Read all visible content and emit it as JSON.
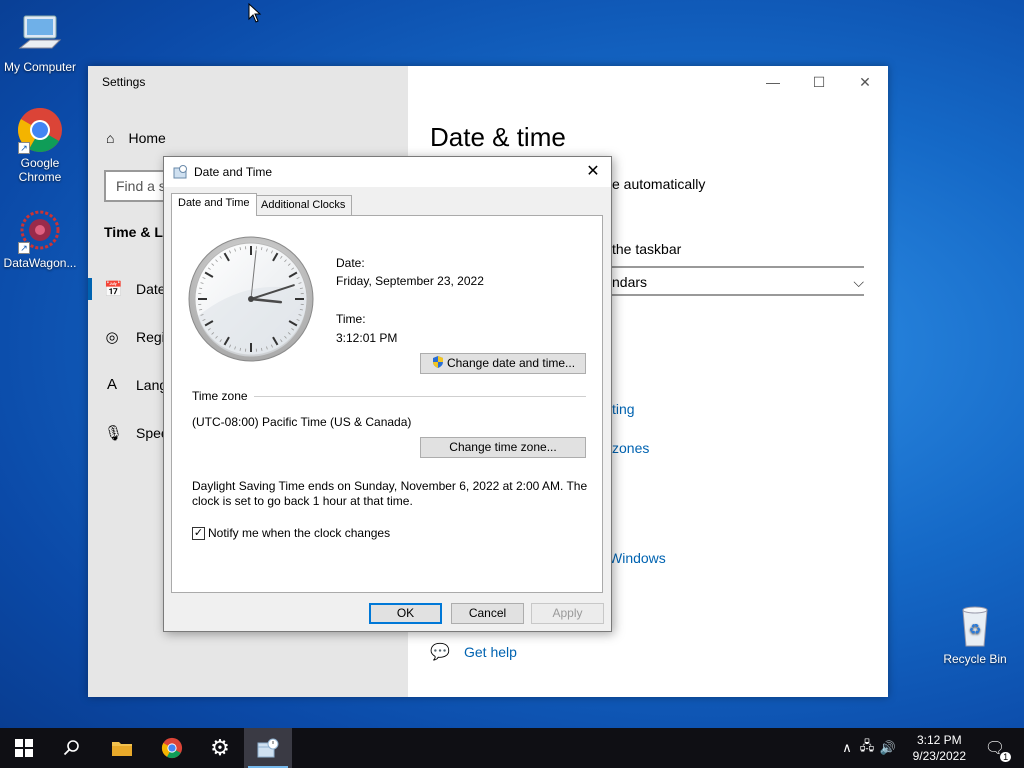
{
  "desktop": {
    "icons": [
      {
        "label": "My Computer"
      },
      {
        "label": "Google Chrome"
      },
      {
        "label": "DataWagon..."
      },
      {
        "label": "Recycle Bin"
      }
    ]
  },
  "settings": {
    "title": "Settings",
    "home": "Home",
    "search_placeholder": "Find a s",
    "section": "Time & La",
    "nav": [
      "Date",
      "Regi",
      "Lang",
      "Spee"
    ],
    "heading": "Date & time",
    "right": {
      "auto": "e automatically",
      "taskbar": "the taskbar",
      "calendars": "ndars",
      "link1": "ting",
      "link2": "zones",
      "link3": "Windows",
      "help": "Get help"
    }
  },
  "dialog": {
    "title": "Date and Time",
    "tabs": [
      "Date and Time",
      "Additional Clocks"
    ],
    "date_label": "Date:",
    "date_value": "Friday, September 23, 2022",
    "time_label": "Time:",
    "time_value": "3:12:01 PM",
    "change_datetime": "Change date and time...",
    "timezone_label": "Time zone",
    "timezone_value": "(UTC-08:00) Pacific Time (US & Canada)",
    "change_timezone": "Change time zone...",
    "dst_line1": "Daylight Saving Time ends on Sunday, November 6, 2022 at 2:00 AM. The",
    "dst_line2": "clock is set to go back 1 hour at that time.",
    "notify_label": "Notify me when the clock changes",
    "notify_checked": true,
    "ok": "OK",
    "cancel": "Cancel",
    "apply": "Apply"
  },
  "clock_face": {
    "hour": 3,
    "minute": 12,
    "second": 1
  },
  "taskbar": {
    "time": "3:12 PM",
    "date": "9/23/2022",
    "notifications": "1"
  },
  "colors": {
    "accent": "#0063b1",
    "taskbar": "#0f0f14"
  }
}
